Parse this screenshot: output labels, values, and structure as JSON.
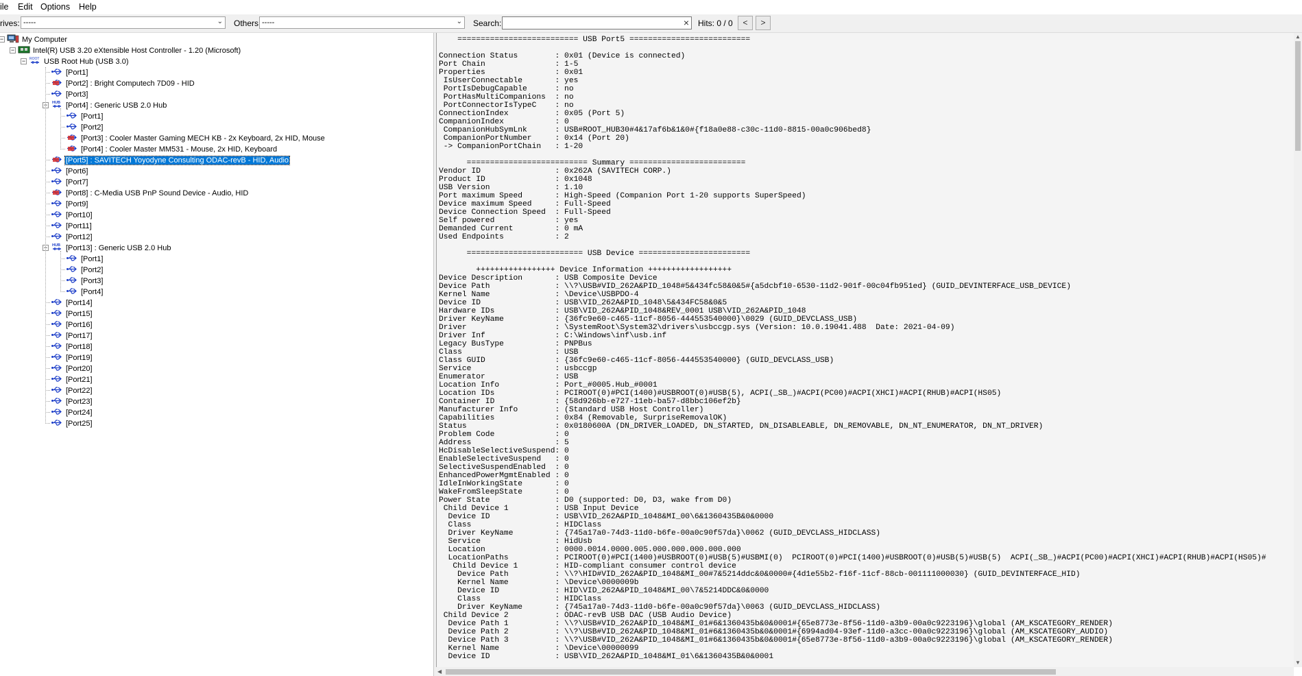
{
  "menu": [
    "ile",
    "Edit",
    "Options",
    "Help"
  ],
  "toolbar": {
    "drives_label": "rives:",
    "drives_value": "-----",
    "others_label": "Others:",
    "others_value": "-----",
    "search_label": "Search:",
    "search_value": "",
    "hits": "Hits: 0 / 0",
    "prev": "<",
    "next": ">"
  },
  "tree": [
    {
      "label": "My Computer",
      "depth": 0,
      "icon": "computer-icon"
    },
    {
      "label": "Intel(R) USB 3.20 eXtensible Host Controller - 1.20 (Microsoft)",
      "depth": 1,
      "icon": "host-controller-icon"
    },
    {
      "label": "USB Root Hub (USB 3.0)",
      "depth": 2,
      "icon": "root-hub-icon"
    },
    {
      "label": "[Port1]",
      "depth": 3,
      "icon": "usb-port-icon"
    },
    {
      "label": "[Port2] : Bright Computech 7D09 - HID",
      "depth": 3,
      "icon": "usb-device-icon"
    },
    {
      "label": "[Port3]",
      "depth": 3,
      "icon": "usb-port-icon"
    },
    {
      "label": "[Port4] : Generic USB 2.0 Hub",
      "depth": 3,
      "icon": "usb-hub-icon"
    },
    {
      "label": "[Port1]",
      "depth": 4,
      "icon": "usb-port-icon"
    },
    {
      "label": "[Port2]",
      "depth": 4,
      "icon": "usb-port-icon"
    },
    {
      "label": "[Port3] : Cooler Master Gaming MECH KB - 2x Keyboard, 2x HID, Mouse",
      "depth": 4,
      "icon": "usb-device-icon"
    },
    {
      "label": "[Port4] : Cooler Master MM531 - Mouse, 2x HID, Keyboard",
      "depth": 4,
      "icon": "usb-device-icon"
    },
    {
      "label": "[Port5] : SAVITECH Yoyodyne Consulting ODAC-revB - HID, Audio",
      "depth": 3,
      "icon": "usb-device-icon",
      "selected": true
    },
    {
      "label": "[Port6]",
      "depth": 3,
      "icon": "usb-port-icon"
    },
    {
      "label": "[Port7]",
      "depth": 3,
      "icon": "usb-port-icon"
    },
    {
      "label": "[Port8] : C-Media USB PnP Sound Device - Audio, HID",
      "depth": 3,
      "icon": "usb-device-icon"
    },
    {
      "label": "[Port9]",
      "depth": 3,
      "icon": "usb-port-icon"
    },
    {
      "label": "[Port10]",
      "depth": 3,
      "icon": "usb-port-icon"
    },
    {
      "label": "[Port11]",
      "depth": 3,
      "icon": "usb-port-icon"
    },
    {
      "label": "[Port12]",
      "depth": 3,
      "icon": "usb-port-icon"
    },
    {
      "label": "[Port13] : Generic USB 2.0 Hub",
      "depth": 3,
      "icon": "usb-hub-icon"
    },
    {
      "label": "[Port1]",
      "depth": 4,
      "icon": "usb-port-icon"
    },
    {
      "label": "[Port2]",
      "depth": 4,
      "icon": "usb-port-icon"
    },
    {
      "label": "[Port3]",
      "depth": 4,
      "icon": "usb-port-icon"
    },
    {
      "label": "[Port4]",
      "depth": 4,
      "icon": "usb-port-icon"
    },
    {
      "label": "[Port14]",
      "depth": 3,
      "icon": "usb-port-icon"
    },
    {
      "label": "[Port15]",
      "depth": 3,
      "icon": "usb-port-icon"
    },
    {
      "label": "[Port16]",
      "depth": 3,
      "icon": "usb-port-icon"
    },
    {
      "label": "[Port17]",
      "depth": 3,
      "icon": "usb-port-icon"
    },
    {
      "label": "[Port18]",
      "depth": 3,
      "icon": "usb-port-icon"
    },
    {
      "label": "[Port19]",
      "depth": 3,
      "icon": "usb-port-icon"
    },
    {
      "label": "[Port20]",
      "depth": 3,
      "icon": "usb-port-icon"
    },
    {
      "label": "[Port21]",
      "depth": 3,
      "icon": "usb-port-icon"
    },
    {
      "label": "[Port22]",
      "depth": 3,
      "icon": "usb-port-icon"
    },
    {
      "label": "[Port23]",
      "depth": 3,
      "icon": "usb-port-icon"
    },
    {
      "label": "[Port24]",
      "depth": 3,
      "icon": "usb-port-icon"
    },
    {
      "label": "[Port25]",
      "depth": 3,
      "icon": "usb-port-icon"
    }
  ],
  "detail_text": "    ========================== USB Port5 ==========================\n\nConnection Status        : 0x01 (Device is connected)\nPort Chain               : 1-5\nProperties               : 0x01\n IsUserConnectable       : yes\n PortIsDebugCapable      : no\n PortHasMultiCompanions  : no\n PortConnectorIsTypeC    : no\nConnectionIndex          : 0x05 (Port 5)\nCompanionIndex           : 0\n CompanionHubSymLnk      : USB#ROOT_HUB30#4&17af6b&1&0#{f18a0e88-c30c-11d0-8815-00a0c906bed8}\n CompanionPortNumber     : 0x14 (Port 20)\n -> CompanionPortChain   : 1-20\n\n      ========================== Summary =========================\nVendor ID                : 0x262A (SAVITECH CORP.)\nProduct ID               : 0x1048\nUSB Version              : 1.10\nPort maximum Speed       : High-Speed (Companion Port 1-20 supports SuperSpeed)\nDevice maximum Speed     : Full-Speed\nDevice Connection Speed  : Full-Speed\nSelf powered             : yes\nDemanded Current         : 0 mA\nUsed Endpoints           : 2\n\n      ========================= USB Device ========================\n\n        +++++++++++++++++ Device Information ++++++++++++++++++\nDevice Description       : USB Composite Device\nDevice Path              : \\\\?\\USB#VID_262A&PID_1048#5&434fc58&0&5#{a5dcbf10-6530-11d2-901f-00c04fb951ed} (GUID_DEVINTERFACE_USB_DEVICE)\nKernel Name              : \\Device\\USBPDO-4\nDevice ID                : USB\\VID_262A&PID_1048\\5&434FC58&0&5\nHardware IDs             : USB\\VID_262A&PID_1048&REV_0001 USB\\VID_262A&PID_1048\nDriver KeyName           : {36fc9e60-c465-11cf-8056-444553540000}\\0029 (GUID_DEVCLASS_USB)\nDriver                   : \\SystemRoot\\System32\\drivers\\usbccgp.sys (Version: 10.0.19041.488  Date: 2021-04-09)\nDriver Inf               : C:\\Windows\\inf\\usb.inf\nLegacy BusType           : PNPBus\nClass                    : USB\nClass GUID               : {36fc9e60-c465-11cf-8056-444553540000} (GUID_DEVCLASS_USB)\nService                  : usbccgp\nEnumerator               : USB\nLocation Info            : Port_#0005.Hub_#0001\nLocation IDs             : PCIROOT(0)#PCI(1400)#USBROOT(0)#USB(5), ACPI(_SB_)#ACPI(PC00)#ACPI(XHCI)#ACPI(RHUB)#ACPI(HS05)\nContainer ID             : {58d926bb-e727-11eb-ba57-d8bbc106ef2b}\nManufacturer Info        : (Standard USB Host Controller)\nCapabilities             : 0x84 (Removable, SurpriseRemovalOK)\nStatus                   : 0x0180600A (DN_DRIVER_LOADED, DN_STARTED, DN_DISABLEABLE, DN_REMOVABLE, DN_NT_ENUMERATOR, DN_NT_DRIVER)\nProblem Code             : 0\nAddress                  : 5\nHcDisableSelectiveSuspend: 0\nEnableSelectiveSuspend   : 0\nSelectiveSuspendEnabled  : 0\nEnhancedPowerMgmtEnabled : 0\nIdleInWorkingState       : 0\nWakeFromSleepState       : 0\nPower State              : D0 (supported: D0, D3, wake from D0)\n Child Device 1          : USB Input Device\n  Device ID              : USB\\VID_262A&PID_1048&MI_00\\6&1360435B&0&0000\n  Class                  : HIDClass\n  Driver KeyName         : {745a17a0-74d3-11d0-b6fe-00a0c90f57da}\\0062 (GUID_DEVCLASS_HIDCLASS)\n  Service                : HidUsb\n  Location               : 0000.0014.0000.005.000.000.000.000.000\n  LocationPaths          : PCIROOT(0)#PCI(1400)#USBROOT(0)#USB(5)#USBMI(0)  PCIROOT(0)#PCI(1400)#USBROOT(0)#USB(5)#USB(5)  ACPI(_SB_)#ACPI(PC00)#ACPI(XHCI)#ACPI(RHUB)#ACPI(HS05)#\n   Child Device 1        : HID-compliant consumer control device\n    Device Path          : \\\\?\\HID#VID_262A&PID_1048&MI_00#7&5214ddc&0&0000#{4d1e55b2-f16f-11cf-88cb-001111000030} (GUID_DEVINTERFACE_HID)\n    Kernel Name          : \\Device\\0000009b\n    Device ID            : HID\\VID_262A&PID_1048&MI_00\\7&5214DDC&0&0000\n    Class                : HIDClass\n    Driver KeyName       : {745a17a0-74d3-11d0-b6fe-00a0c90f57da}\\0063 (GUID_DEVCLASS_HIDCLASS)\n Child Device 2          : ODAC-revB USB DAC (USB Audio Device)\n  Device Path 1          : \\\\?\\USB#VID_262A&PID_1048&MI_01#6&1360435b&0&0001#{65e8773e-8f56-11d0-a3b9-00a0c9223196}\\global (AM_KSCATEGORY_RENDER)\n  Device Path 2          : \\\\?\\USB#VID_262A&PID_1048&MI_01#6&1360435b&0&0001#{6994ad04-93ef-11d0-a3cc-00a0c9223196}\\global (AM_KSCATEGORY_AUDIO)\n  Device Path 3          : \\\\?\\USB#VID_262A&PID_1048&MI_01#6&1360435b&0&0001#{65e8773e-8f56-11d0-a3b9-00a0c9223196}\\global (AM_KSCATEGORY_RENDER)\n  Kernel Name            : \\Device\\00000099\n  Device ID              : USB\\VID_262A&PID_1048&MI_01\\6&1360435B&0&0001"
}
